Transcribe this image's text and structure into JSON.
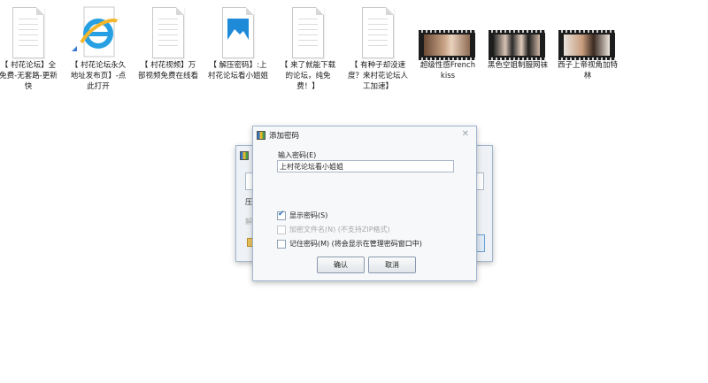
{
  "desktop": {
    "files": [
      {
        "label": "【 村花论坛】全免费-无套路-更新快",
        "kind": "doc"
      },
      {
        "label": "【 村花论坛永久地址发布页】-点此打开",
        "kind": "ie"
      },
      {
        "label": "【 村花视频】万部视频免费在线看",
        "kind": "doc"
      },
      {
        "label": "【 解压密码】:上村花论坛看小姐姐",
        "kind": "image"
      },
      {
        "label": "【 来了就能下载的论坛，纯免费！】",
        "kind": "doc"
      },
      {
        "label": "【 有种子却没速度？来村花论坛人工加速】",
        "kind": "doc"
      },
      {
        "label": "超级性感French kiss",
        "kind": "video"
      },
      {
        "label": "黑色空姐制服网袜",
        "kind": "video"
      },
      {
        "label": "西子上帝视角加特林",
        "kind": "video"
      }
    ]
  },
  "dialog": {
    "title": "添加密码",
    "password_label": "输入密码(E)",
    "password_value": "上村花论坛看小姐姐",
    "show_password": {
      "label": "显示密码(S)",
      "checked": true
    },
    "encrypt_names": {
      "label": "加密文件名(N) (不支持ZIP格式)",
      "checked": false,
      "disabled": true
    },
    "remember": {
      "label": "记住密码(M) (将会显示在管理密码窗口中)",
      "checked": false
    },
    "ok_label": "确认",
    "cancel_label": "取消"
  },
  "back_dialog": {
    "fragment_1": "压",
    "fragment_2": "解"
  }
}
